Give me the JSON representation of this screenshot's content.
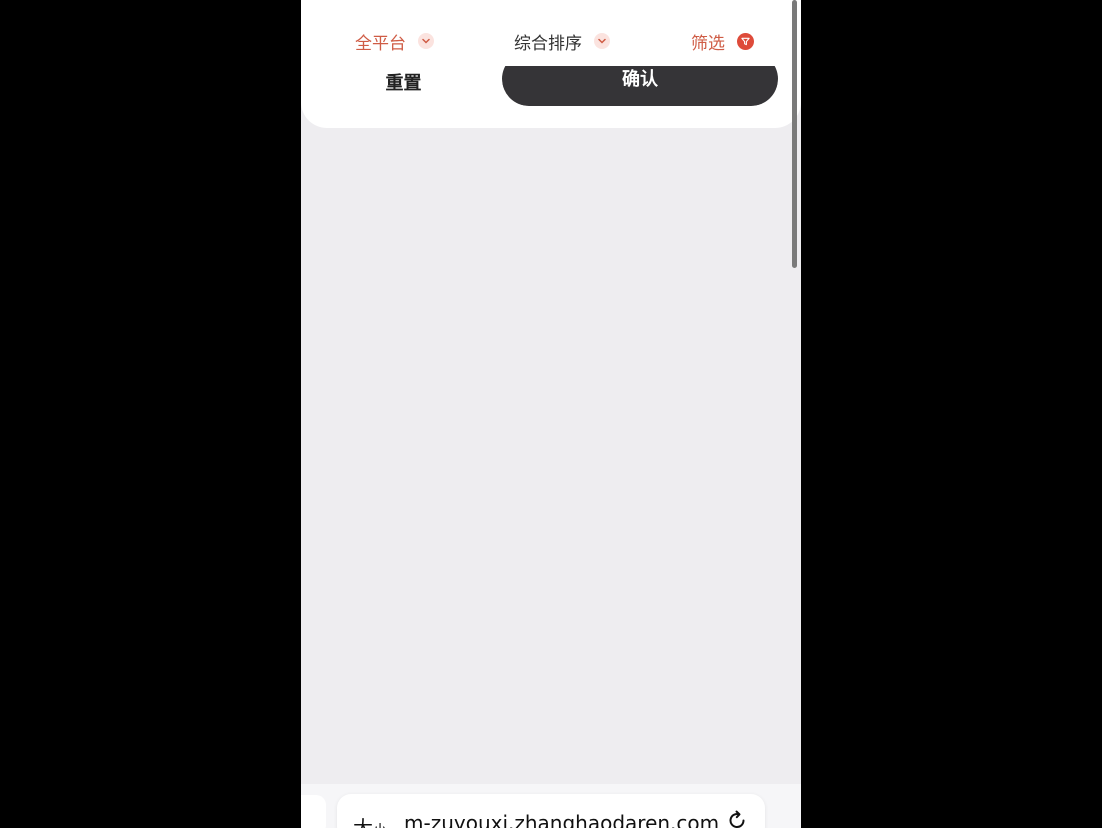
{
  "filters": {
    "platform": "全平台",
    "sort": "综合排序",
    "filter": "筛选"
  },
  "actions": {
    "reset": "重置",
    "confirm": "确认"
  },
  "browser": {
    "text_size_big": "大",
    "text_size_small": "小",
    "url": "m-zuyouxi.zhanghaodaren.com",
    "reload_icon": "reload-icon"
  },
  "colors": {
    "accent": "#cf5c45",
    "filter_dot": "#de4b3a",
    "confirm_bg": "#353437",
    "page_bg": "#eeedf0"
  }
}
